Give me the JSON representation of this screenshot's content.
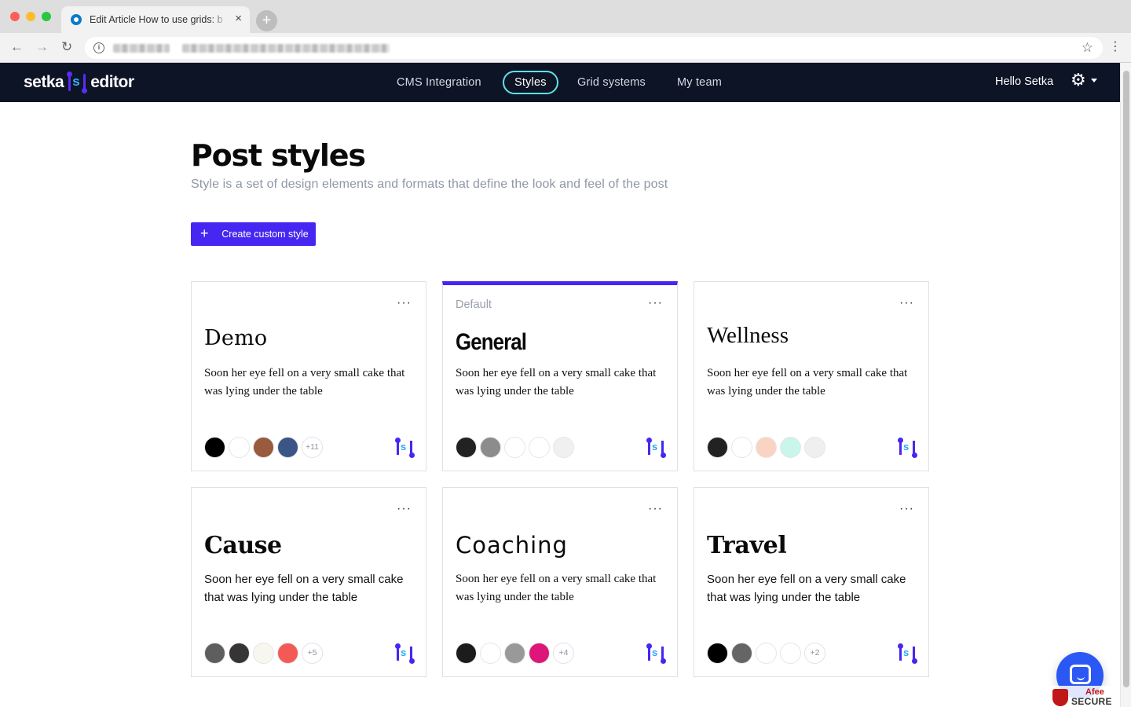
{
  "browser": {
    "tab_title": "Edit Article How to use grids: b",
    "tab_close": "×",
    "new_tab": "+"
  },
  "app": {
    "logo_left": "setka",
    "logo_mark": "s",
    "logo_right": "editor",
    "nav": [
      {
        "label": "CMS Integration",
        "active": false
      },
      {
        "label": "Styles",
        "active": true
      },
      {
        "label": "Grid systems",
        "active": false
      },
      {
        "label": "My team",
        "active": false
      }
    ],
    "greeting": "Hello Setka"
  },
  "page": {
    "title": "Post styles",
    "subtitle": "Style is a set of design elements and formats that define the look and feel of the post",
    "create_button": "Create custom style"
  },
  "cards": [
    {
      "tag": "",
      "name": "Demo",
      "description": "Soon her eye fell on a very small cake that was lying under the table",
      "swatches": [
        "#000000",
        "#ffffff",
        "#995a3d",
        "#3c5587"
      ],
      "more_count": "+11"
    },
    {
      "tag": "Default",
      "name": "General",
      "description": "Soon her eye fell on a very small cake that was lying under the table",
      "swatches": [
        "#222222",
        "#8c8c8c",
        "#ffffff",
        "#ffffff",
        "#f0f0f0"
      ],
      "more_count": ""
    },
    {
      "tag": "",
      "name": "Wellness",
      "description": "Soon her eye fell on a very small cake that was lying under the table",
      "swatches": [
        "#222222",
        "#ffffff",
        "#fbd3c2",
        "#c9f5ea",
        "#efefef"
      ],
      "more_count": ""
    },
    {
      "tag": "",
      "name": "Cause",
      "description": "Soon her eye fell on a very small cake that was lying under the table",
      "swatches": [
        "#5e5e5e",
        "#373435",
        "#f7f7f0",
        "#f45a55"
      ],
      "more_count": "+5"
    },
    {
      "tag": "",
      "name": "Coaching",
      "description": "Soon her eye fell on a very small cake that was lying under the table",
      "swatches": [
        "#1c1c1c",
        "#ffffff",
        "#999999",
        "#df1679"
      ],
      "more_count": "+4"
    },
    {
      "tag": "",
      "name": "Travel",
      "description": "Soon her eye fell on a very small cake that was lying under the table",
      "swatches": [
        "#000000",
        "#656565",
        "#ffffff",
        "#ffffff"
      ],
      "more_count": "+2"
    }
  ],
  "card_menu": "···",
  "badge": {
    "line1": "Afee",
    "line2": "SECURE"
  },
  "colors": {
    "accent": "#4527f1",
    "header_bg": "#0d1426",
    "nav_active_border": "#5ee1e6",
    "chat": "#2b57f4"
  },
  "icons": {
    "settings": "gear-icon",
    "chat": "chat-icon",
    "brand": "setka-mark-icon",
    "bookmark": "star-icon"
  }
}
